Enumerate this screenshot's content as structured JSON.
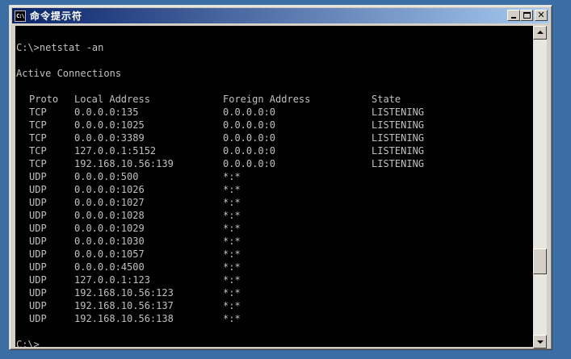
{
  "window": {
    "title": "命令提示符",
    "icon_text": "C:\\",
    "icon_name": "cmd-icon"
  },
  "console": {
    "command_line": "C:\\>netstat -an",
    "section_title": "Active Connections",
    "headers": {
      "proto": "Proto",
      "local": "Local Address",
      "foreign": "Foreign Address",
      "state": "State"
    },
    "rows": [
      {
        "proto": "TCP",
        "local": "0.0.0.0:135",
        "foreign": "0.0.0.0:0",
        "state": "LISTENING"
      },
      {
        "proto": "TCP",
        "local": "0.0.0.0:1025",
        "foreign": "0.0.0.0:0",
        "state": "LISTENING"
      },
      {
        "proto": "TCP",
        "local": "0.0.0.0:3389",
        "foreign": "0.0.0.0:0",
        "state": "LISTENING"
      },
      {
        "proto": "TCP",
        "local": "127.0.0.1:5152",
        "foreign": "0.0.0.0:0",
        "state": "LISTENING"
      },
      {
        "proto": "TCP",
        "local": "192.168.10.56:139",
        "foreign": "0.0.0.0:0",
        "state": "LISTENING"
      },
      {
        "proto": "UDP",
        "local": "0.0.0.0:500",
        "foreign": "*:*",
        "state": ""
      },
      {
        "proto": "UDP",
        "local": "0.0.0.0:1026",
        "foreign": "*:*",
        "state": ""
      },
      {
        "proto": "UDP",
        "local": "0.0.0.0:1027",
        "foreign": "*:*",
        "state": ""
      },
      {
        "proto": "UDP",
        "local": "0.0.0.0:1028",
        "foreign": "*:*",
        "state": ""
      },
      {
        "proto": "UDP",
        "local": "0.0.0.0:1029",
        "foreign": "*:*",
        "state": ""
      },
      {
        "proto": "UDP",
        "local": "0.0.0.0:1030",
        "foreign": "*:*",
        "state": ""
      },
      {
        "proto": "UDP",
        "local": "0.0.0.0:1057",
        "foreign": "*:*",
        "state": ""
      },
      {
        "proto": "UDP",
        "local": "0.0.0.0:4500",
        "foreign": "*:*",
        "state": ""
      },
      {
        "proto": "UDP",
        "local": "127.0.0.1:123",
        "foreign": "*:*",
        "state": ""
      },
      {
        "proto": "UDP",
        "local": "192.168.10.56:123",
        "foreign": "*:*",
        "state": ""
      },
      {
        "proto": "UDP",
        "local": "192.168.10.56:137",
        "foreign": "*:*",
        "state": ""
      },
      {
        "proto": "UDP",
        "local": "192.168.10.56:138",
        "foreign": "*:*",
        "state": ""
      }
    ],
    "prompt": "C:\\>"
  },
  "scrollbar": {
    "position_fraction": 0.86
  },
  "colors": {
    "desktop": "#3a6ea5",
    "title_start": "#0a246a",
    "title_end": "#a6caf0",
    "console_bg": "#000000",
    "console_text": "#c0c0c0"
  }
}
